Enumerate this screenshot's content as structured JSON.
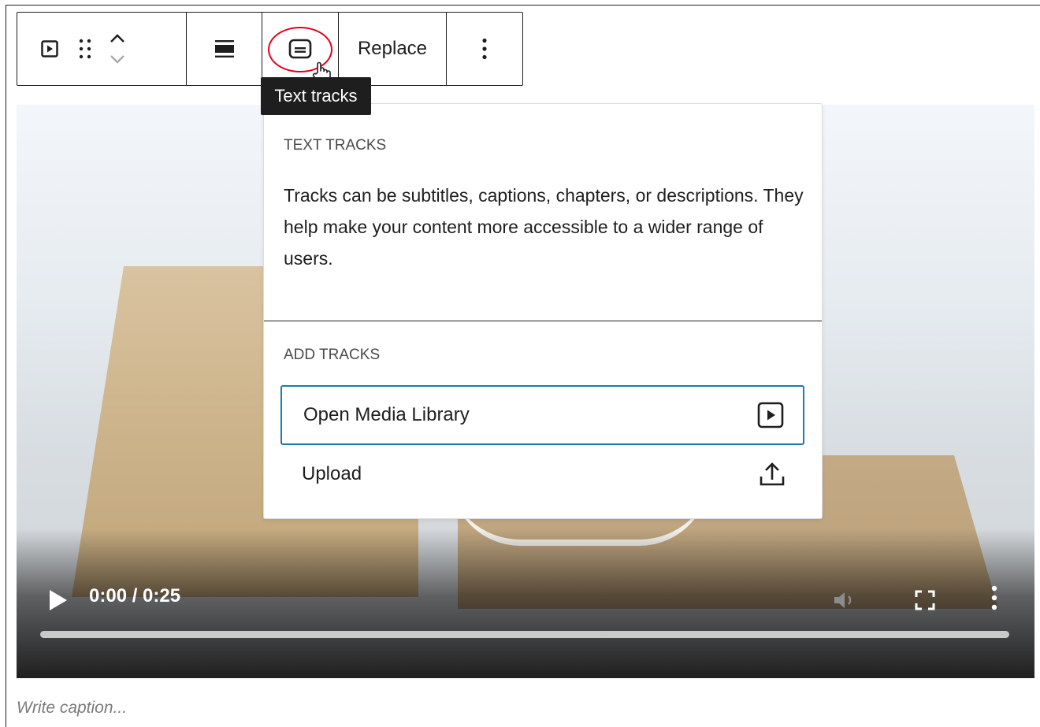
{
  "toolbar": {
    "replace_label": "Replace",
    "icons": [
      "video-block-icon",
      "drag-handle-icon",
      "move-up-icon",
      "move-down-icon",
      "align-icon",
      "text-tracks-icon",
      "more-options-icon"
    ]
  },
  "tooltip": {
    "text": "Text tracks"
  },
  "popover": {
    "heading": "TEXT TRACKS",
    "description": "Tracks can be subtitles, captions, chapters, or descriptions. They help make your content more accessible to a wider range of users.",
    "add_heading": "ADD TRACKS",
    "items": [
      {
        "label": "Open Media Library",
        "icon": "media-library-icon"
      },
      {
        "label": "Upload",
        "icon": "upload-icon"
      }
    ]
  },
  "video": {
    "time_display": "0:00 / 0:25",
    "progress": 0
  },
  "caption": {
    "placeholder": "Write caption..."
  },
  "colors": {
    "highlight": "#e0001b",
    "focus": "#1a7bb0",
    "tooltip_bg": "#1e1e1e"
  }
}
